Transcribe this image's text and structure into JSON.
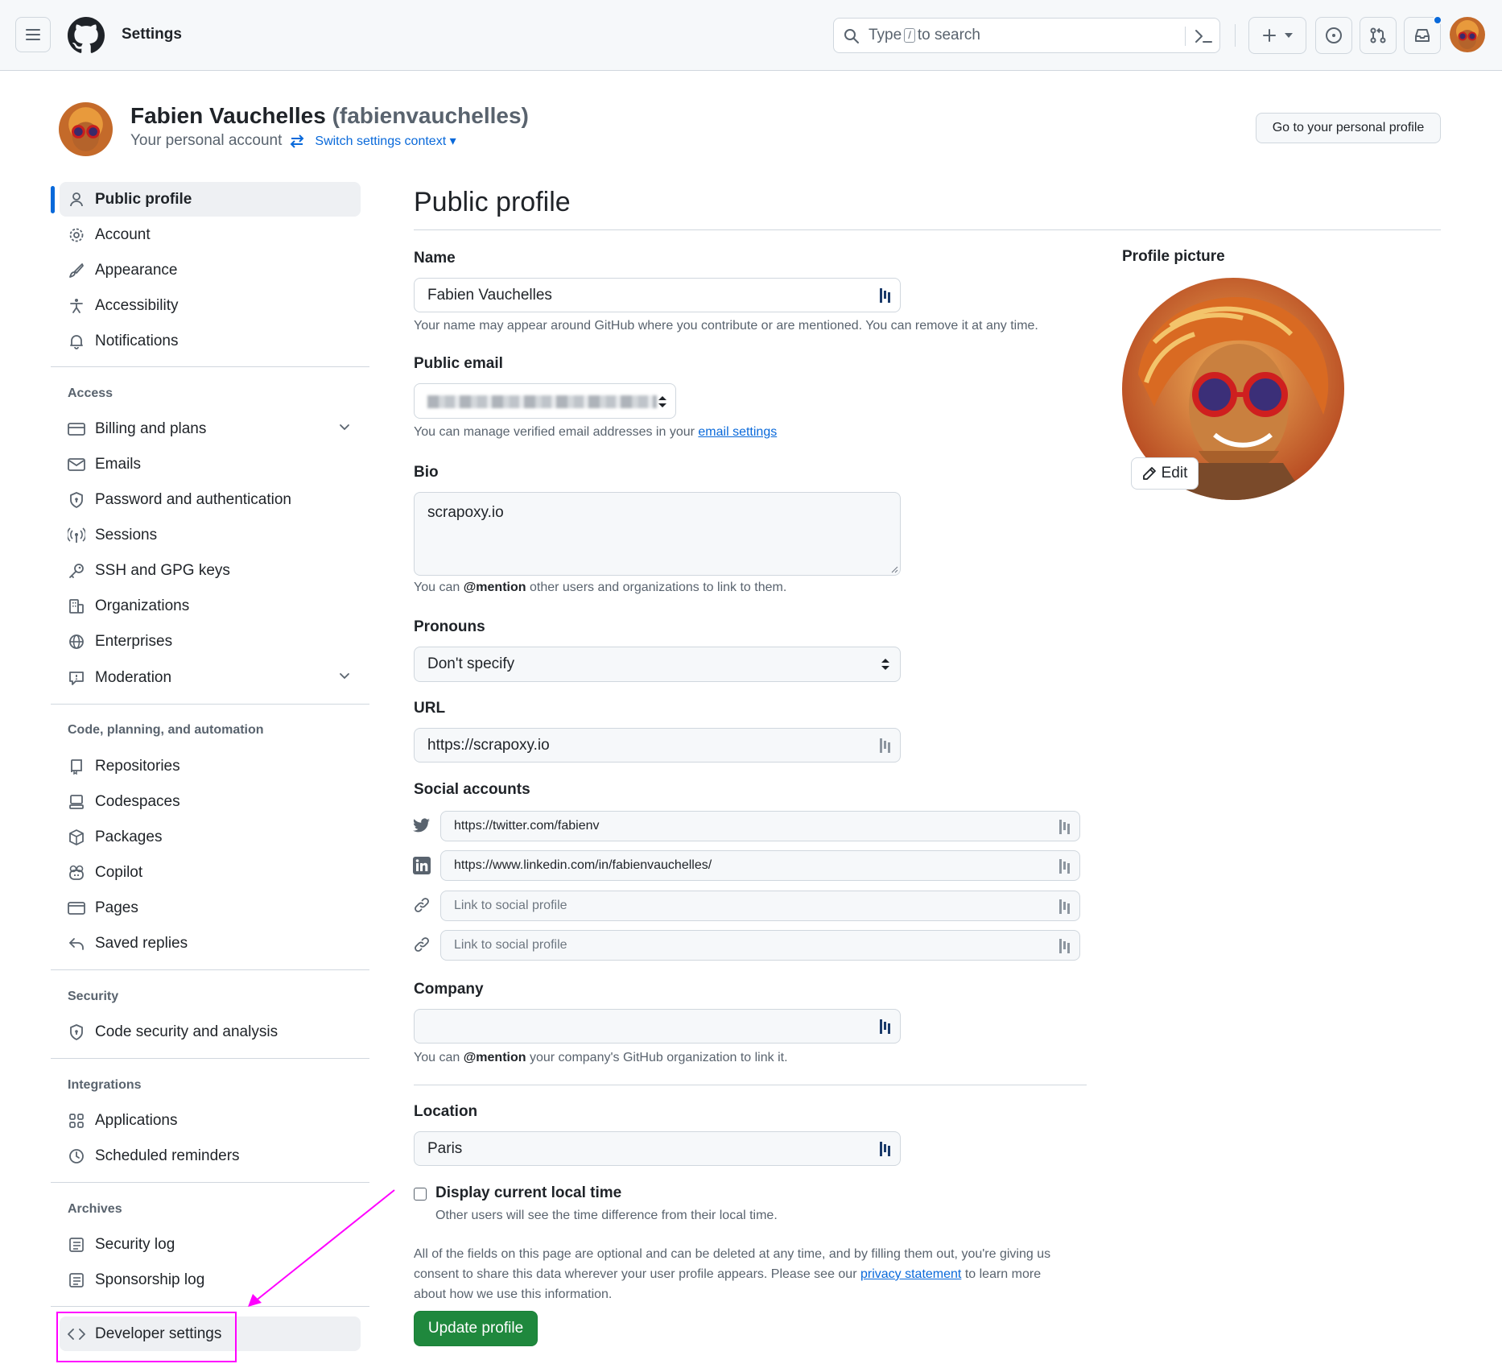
{
  "header": {
    "title": "Settings",
    "search_prefix": "Type",
    "search_key": "/",
    "search_suffix": "to search"
  },
  "account": {
    "display_name": "Fabien Vauchelles",
    "username": "(fabienvauchelles)",
    "subtitle": "Your personal account",
    "switch_context": "Switch settings context",
    "go_profile": "Go to your personal profile"
  },
  "sidebar": {
    "items_top": [
      {
        "label": "Public profile",
        "icon": "person-icon"
      },
      {
        "label": "Account",
        "icon": "gear-icon"
      },
      {
        "label": "Appearance",
        "icon": "paintbrush-icon"
      },
      {
        "label": "Accessibility",
        "icon": "accessibility-icon"
      },
      {
        "label": "Notifications",
        "icon": "bell-icon"
      }
    ],
    "access_heading": "Access",
    "access": [
      {
        "label": "Billing and plans",
        "icon": "credit-card-icon"
      },
      {
        "label": "Emails",
        "icon": "mail-icon"
      },
      {
        "label": "Password and authentication",
        "icon": "shield-lock-icon"
      },
      {
        "label": "Sessions",
        "icon": "broadcast-icon"
      },
      {
        "label": "SSH and GPG keys",
        "icon": "key-icon"
      },
      {
        "label": "Organizations",
        "icon": "organization-icon"
      },
      {
        "label": "Enterprises",
        "icon": "globe-icon"
      },
      {
        "label": "Moderation",
        "icon": "report-icon"
      }
    ],
    "code_heading": "Code, planning, and automation",
    "code": [
      {
        "label": "Repositories",
        "icon": "repo-icon"
      },
      {
        "label": "Codespaces",
        "icon": "codespaces-icon"
      },
      {
        "label": "Packages",
        "icon": "package-icon"
      },
      {
        "label": "Copilot",
        "icon": "copilot-icon"
      },
      {
        "label": "Pages",
        "icon": "browser-icon"
      },
      {
        "label": "Saved replies",
        "icon": "reply-icon"
      }
    ],
    "security_heading": "Security",
    "security": [
      {
        "label": "Code security and analysis",
        "icon": "shield-lock-icon"
      }
    ],
    "integrations_heading": "Integrations",
    "integrations": [
      {
        "label": "Applications",
        "icon": "apps-icon"
      },
      {
        "label": "Scheduled reminders",
        "icon": "clock-icon"
      }
    ],
    "archives_heading": "Archives",
    "archives": [
      {
        "label": "Security log",
        "icon": "log-icon"
      },
      {
        "label": "Sponsorship log",
        "icon": "log-icon"
      }
    ],
    "developer": {
      "label": "Developer settings",
      "icon": "code-icon"
    }
  },
  "main": {
    "title": "Public profile",
    "name_label": "Name",
    "name_value": "Fabien Vauchelles",
    "name_hint": "Your name may appear around GitHub where you contribute or are mentioned. You can remove it at any time.",
    "email_label": "Public email",
    "email_hint_prefix": "You can manage verified email addresses in your",
    "email_hint_link": "email settings",
    "bio_label": "Bio",
    "bio_value": "scrapoxy.io",
    "bio_hint_prefix": "You can",
    "bio_hint_bold": "@mention",
    "bio_hint_suffix": "other users and organizations to link to them.",
    "pronouns_label": "Pronouns",
    "pronouns_value": "Don't specify",
    "url_label": "URL",
    "url_value": "https://scrapoxy.io",
    "social_label": "Social accounts",
    "social": [
      {
        "icon": "twitter-icon",
        "value": "https://twitter.com/fabienv",
        "placeholder": "Link to social profile"
      },
      {
        "icon": "linkedin-icon",
        "value": "https://www.linkedin.com/in/fabienvauchelles/",
        "placeholder": "Link to social profile"
      },
      {
        "icon": "link-icon",
        "value": "",
        "placeholder": "Link to social profile"
      },
      {
        "icon": "link-icon",
        "value": "",
        "placeholder": "Link to social profile"
      }
    ],
    "company_label": "Company",
    "company_value": "",
    "company_hint_prefix": "You can",
    "company_hint_bold": "@mention",
    "company_hint_suffix": "your company's GitHub organization to link it.",
    "location_label": "Location",
    "location_value": "Paris",
    "localtime_label": "Display current local time",
    "localtime_hint": "Other users will see the time difference from their local time.",
    "footer_line1": "All of the fields on this page are optional and can be deleted at any time, and by filling them out, you're giving us",
    "footer_line2_prefix": "consent to share this data wherever your user profile appears. Please see our",
    "footer_link": "privacy statement",
    "footer_line2_suffix": "to learn more",
    "footer_line3": "about how we use this information.",
    "update_button": "Update profile"
  },
  "profile_picture": {
    "label": "Profile picture",
    "edit": "Edit"
  },
  "colors": {
    "accent": "#0969da",
    "primary_button": "#1f883d",
    "annotation": "#ff00ff"
  }
}
